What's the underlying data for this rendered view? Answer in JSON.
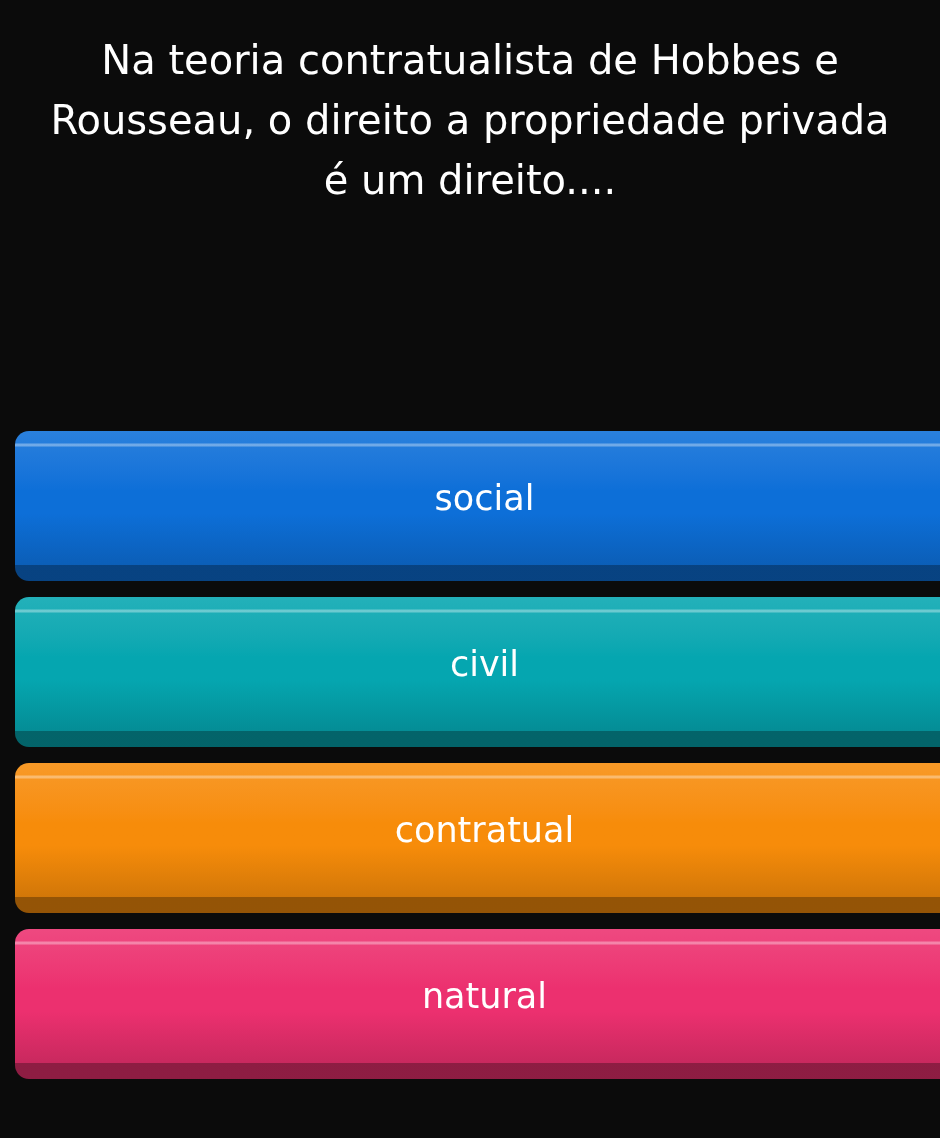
{
  "question": "Na teoria contratualista de Hobbes e Rousseau, o direito a propriedade privada é um direito....",
  "answers": [
    {
      "label": "social",
      "color": "#0d6fd8"
    },
    {
      "label": "civil",
      "color": "#05a6b0"
    },
    {
      "label": "contratual",
      "color": "#f78c0a"
    },
    {
      "label": "natural",
      "color": "#ec306f"
    }
  ]
}
